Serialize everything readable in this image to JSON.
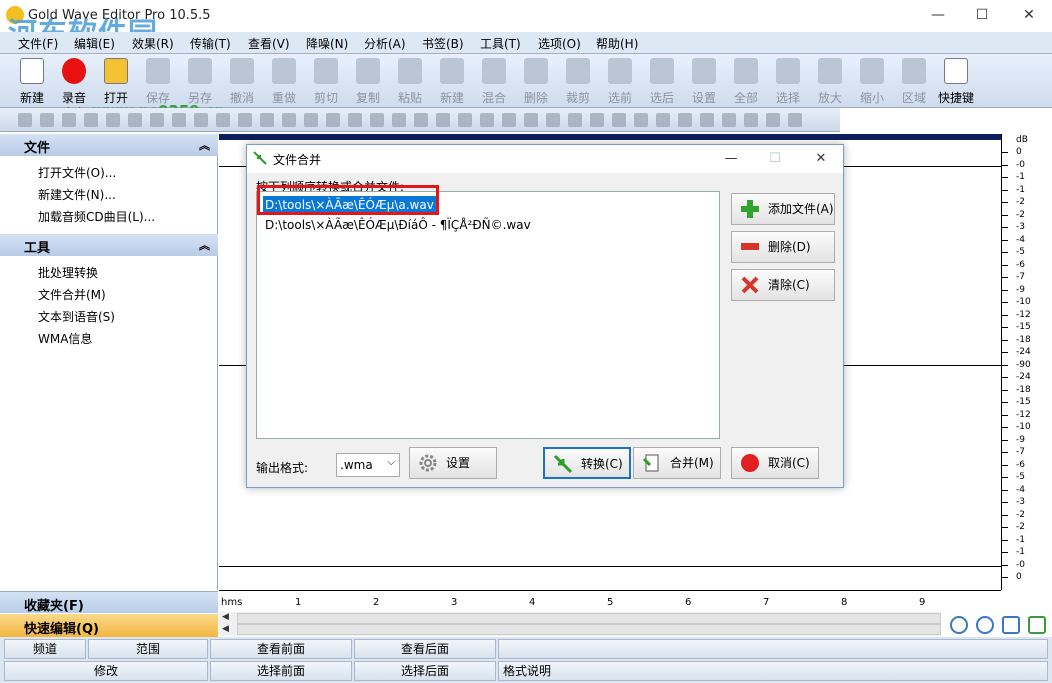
{
  "app": {
    "title": "Gold Wave Editor Pro 10.5.5"
  },
  "watermark": {
    "text": "河东软件园",
    "url": "www.pc0359.cn"
  },
  "window_controls": {
    "minimize": "—",
    "maximize": "☐",
    "close": "✕"
  },
  "menu": [
    "文件(F)",
    "编辑(E)",
    "效果(R)",
    "传输(T)",
    "查看(V)",
    "降噪(N)",
    "分析(A)",
    "书签(B)",
    "工具(T)",
    "选项(O)",
    "帮助(H)"
  ],
  "toolbar": [
    {
      "label": "新建",
      "enabled": true,
      "color": "#ffffff"
    },
    {
      "label": "录音(R)",
      "enabled": true,
      "color": "#e81010"
    },
    {
      "label": "打开",
      "enabled": true,
      "color": "#f2c230"
    },
    {
      "label": "保存",
      "enabled": false
    },
    {
      "label": "另存",
      "enabled": false
    },
    {
      "label": "撤消",
      "enabled": false
    },
    {
      "label": "重做",
      "enabled": false
    },
    {
      "label": "剪切",
      "enabled": false
    },
    {
      "label": "复制",
      "enabled": false
    },
    {
      "label": "粘贴",
      "enabled": false
    },
    {
      "label": "新建",
      "enabled": false
    },
    {
      "label": "混合",
      "enabled": false
    },
    {
      "label": "删除",
      "enabled": false
    },
    {
      "label": "裁剪",
      "enabled": false
    },
    {
      "label": "选前",
      "enabled": false
    },
    {
      "label": "选后",
      "enabled": false
    },
    {
      "label": "设置",
      "enabled": false
    },
    {
      "label": "全部",
      "enabled": false
    },
    {
      "label": "选择",
      "enabled": false
    },
    {
      "label": "放大",
      "enabled": false
    },
    {
      "label": "缩小",
      "enabled": false
    },
    {
      "label": "区域",
      "enabled": false
    },
    {
      "label": "快捷键",
      "enabled": true,
      "color": "#ffffff"
    }
  ],
  "leftpanel": {
    "file_section": {
      "title": "文件",
      "items": [
        "打开文件(O)...",
        "新建文件(N)...",
        "加载音频CD曲目(L)..."
      ]
    },
    "tools_section": {
      "title": "工具",
      "items": [
        "批处理转换",
        "文件合并(M)",
        "文本到语音(S)",
        "WMA信息"
      ]
    },
    "favorites": "收藏夹(F)",
    "quick_edit": "快速编辑(Q)"
  },
  "db_scale": {
    "unit": "dB",
    "labels": [
      "0",
      "-0",
      "-1",
      "-1",
      "-2",
      "-2",
      "-3",
      "-4",
      "-5",
      "-6",
      "-7",
      "-9",
      "-10",
      "-12",
      "-15",
      "-18",
      "-24",
      "-90",
      "-24",
      "-18",
      "-15",
      "-12",
      "-10",
      "-9",
      "-7",
      "-6",
      "-5",
      "-4",
      "-3",
      "-2",
      "-2",
      "-1",
      "-1",
      "-0",
      "0"
    ]
  },
  "timeline": {
    "unit": "hms",
    "ticks": [
      "1",
      "2",
      "3",
      "4",
      "5",
      "6",
      "7",
      "8",
      "9"
    ]
  },
  "bottombar": {
    "row1": [
      "频道",
      "范围",
      "查看前面",
      "查看后面"
    ],
    "row2": [
      "修改",
      "选择前面",
      "选择后面",
      "格式说明"
    ]
  },
  "dialog": {
    "title": "文件合并",
    "instruction": "按下列顺序转换或合并文件:",
    "files": [
      "D:\\tools\\×ÀÃæ\\ÊÓÆµ\\a.wav",
      "D:\\tools\\×ÀÃæ\\ÊÓÆµ\\ÐíáÔ - ¶ÏÇÅ²ÐÑ©.wav"
    ],
    "buttons": {
      "add": "添加文件(A)",
      "delete": "删除(D)",
      "clear": "清除(C)",
      "settings": "设置",
      "convert": "转换(C)",
      "merge": "合并(M)",
      "cancel": "取消(C)"
    },
    "format_label": "输出格式:",
    "format_value": ".wma",
    "controls": {
      "min": "—",
      "max": "☐",
      "close": "✕"
    }
  }
}
